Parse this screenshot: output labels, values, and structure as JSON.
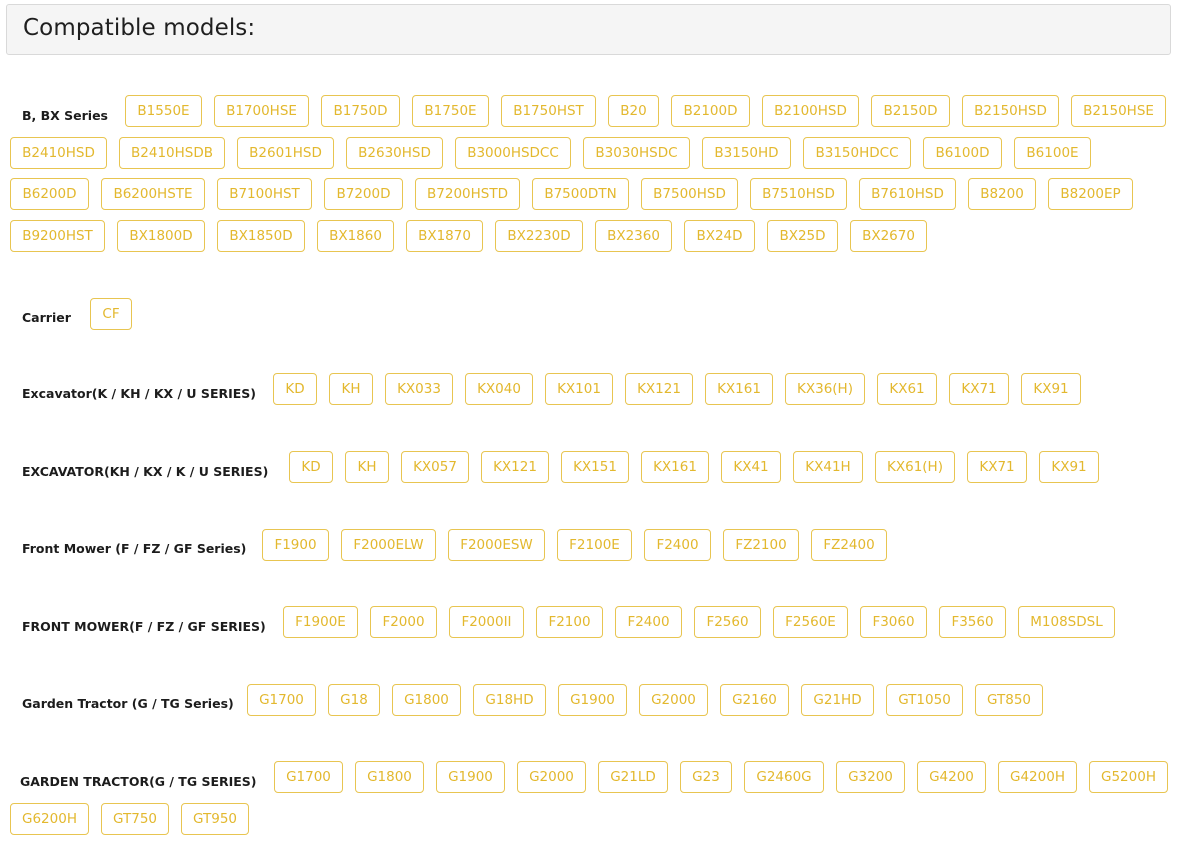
{
  "title": "Compatible models:",
  "groups": [
    {
      "label": "B, BX Series",
      "tags": [
        "B1550E",
        "B1700HSE",
        "B1750D",
        "B1750E",
        "B1750HST",
        "B20",
        "B2100D",
        "B2100HSD",
        "B2150D",
        "B2150HSD",
        "B2150HSE",
        "B2410HSD",
        "B2410HSDB",
        "B2601HSD",
        "B2630HSD",
        "B3000HSDCC",
        "B3030HSDC",
        "B3150HD",
        "B3150HDCC",
        "B6100D",
        "B6100E",
        "B6200D",
        "B6200HSTE",
        "B7100HST",
        "B7200D",
        "B7200HSTD",
        "B7500DTN",
        "B7500HSD",
        "B7510HSD",
        "B7610HSD",
        "B8200",
        "B8200EP",
        "B9200HST",
        "BX1800D",
        "BX1850D",
        "BX1860",
        "BX1870",
        "BX2230D",
        "BX2360",
        "BX24D",
        "BX25D",
        "BX2670"
      ]
    },
    {
      "label": "Carrier",
      "tags": [
        "CF"
      ]
    },
    {
      "label": "Excavator(K / KH / KX / U SERIES)",
      "tags": [
        "KD",
        "KH",
        "KX033",
        "KX040",
        "KX101",
        "KX121",
        "KX161",
        "KX36(H)",
        "KX61",
        "KX71",
        "KX91"
      ]
    },
    {
      "label": "EXCAVATOR(KH / KX / K / U SERIES)",
      "tags": [
        "KD",
        "KH",
        "KX057",
        "KX121",
        "KX151",
        "KX161",
        "KX41",
        "KX41H",
        "KX61(H)",
        "KX71",
        "KX91"
      ]
    },
    {
      "label": "Front Mower (F / FZ / GF Series)",
      "tags": [
        "F1900",
        "F2000ELW",
        "F2000ESW",
        "F2100E",
        "F2400",
        "FZ2100",
        "FZ2400"
      ]
    },
    {
      "label": "FRONT MOWER(F / FZ / GF SERIES)",
      "tags": [
        "F1900E",
        "F2000",
        "F2000II",
        "F2100",
        "F2400",
        "F2560",
        "F2560E",
        "F3060",
        "F3560",
        "M108SDSL"
      ]
    },
    {
      "label": "Garden Tractor (G / TG Series)",
      "tags": [
        "G1700",
        "G18",
        "G1800",
        "G18HD",
        "G1900",
        "G2000",
        "G2160",
        "G21HD",
        "GT1050",
        "GT850"
      ]
    },
    {
      "label": "GARDEN TRACTOR(G / TG SERIES)",
      "tags": [
        "G1700",
        "G1800",
        "G1900",
        "G2000",
        "G21LD",
        "G23",
        "G2460G",
        "G3200",
        "G4200",
        "G4200H",
        "G5200H",
        "G6200H",
        "GT750",
        "GT950"
      ]
    }
  ]
}
